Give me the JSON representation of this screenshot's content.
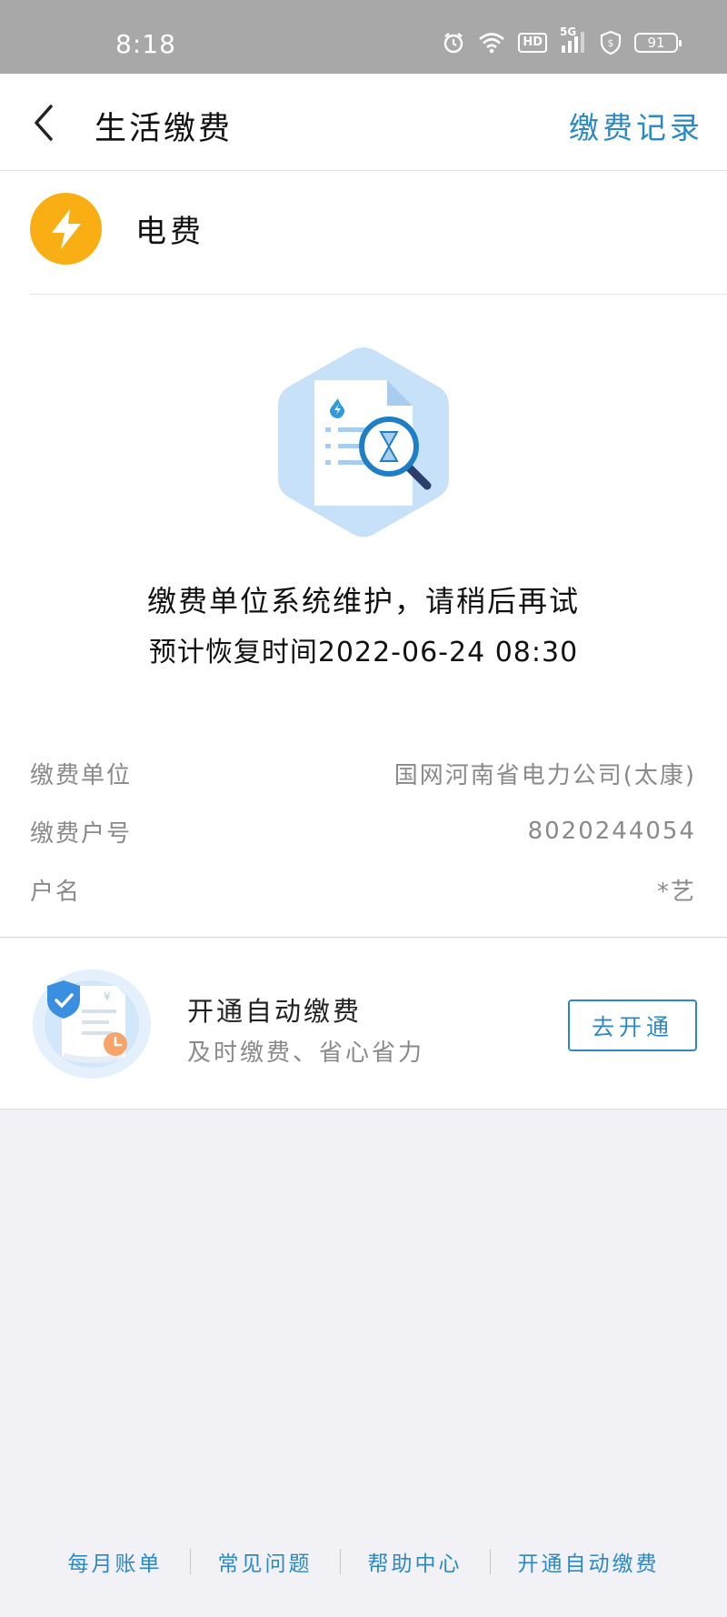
{
  "status_bar": {
    "time": "8:18",
    "icons": [
      "alarm-icon",
      "wifi-icon",
      "hd-icon",
      "signal-5g-icon",
      "shield-dollar-icon",
      "battery-icon"
    ],
    "hd_label": "HD",
    "network_label": "5G",
    "battery": "91"
  },
  "nav": {
    "back_icon": "chevron-left-icon",
    "title": "生活缴费",
    "record_label": "缴费记录"
  },
  "bill_type": {
    "icon": "lightning-icon",
    "icon_color": "#f9ae14",
    "label": "电费"
  },
  "maintenance": {
    "illustration": "document-search-icon",
    "message": "缴费单位系统维护，请稍后再试",
    "recovery": "预计恢复时间2022-06-24 08:30"
  },
  "info": {
    "unit_label": "缴费单位",
    "unit_value": "国网河南省电力公司(太康)",
    "account_label": "缴费户号",
    "account_value": "8020244054",
    "name_label": "户名",
    "name_value": "*艺"
  },
  "auto_pay": {
    "illustration": "shield-bill-clock-icon",
    "title": "开通自动缴费",
    "subtitle": "及时缴费、省心省力",
    "button": "去开通"
  },
  "footer": {
    "links": [
      "每月账单",
      "常见问题",
      "帮助中心",
      "开通自动缴费"
    ]
  },
  "colors": {
    "accent": "#2b8ac6",
    "bolt": "#f9ae14",
    "background": "#f2f1f6"
  }
}
